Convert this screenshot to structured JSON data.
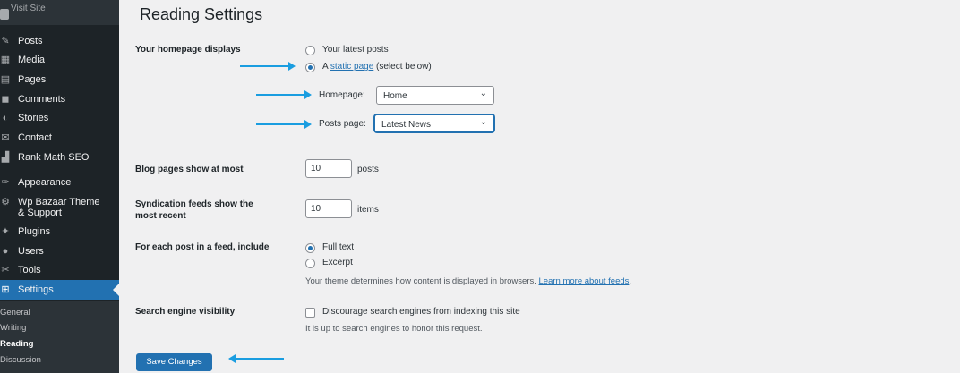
{
  "sidebar": {
    "visit_site": "Visit Site",
    "items": [
      {
        "label": "Posts",
        "icon": "pushpin-icon",
        "glyph": "✎"
      },
      {
        "label": "Media",
        "icon": "media-icon",
        "glyph": "▦"
      },
      {
        "label": "Pages",
        "icon": "pages-icon",
        "glyph": "▤"
      },
      {
        "label": "Comments",
        "icon": "comments-icon",
        "glyph": "◼"
      },
      {
        "label": "Stories",
        "icon": "stories-icon",
        "glyph": "◐"
      },
      {
        "label": "Contact",
        "icon": "contact-icon",
        "glyph": "✉"
      },
      {
        "label": "Rank Math SEO",
        "icon": "rank-math-icon",
        "glyph": "▟"
      },
      {
        "label": "Appearance",
        "icon": "appearance-icon",
        "glyph": "✑"
      },
      {
        "label": "Wp Bazaar Theme",
        "label2": "& Support",
        "icon": "theme-support-icon",
        "glyph": "⚙"
      },
      {
        "label": "Plugins",
        "icon": "plugins-icon",
        "glyph": "✦"
      },
      {
        "label": "Users",
        "icon": "users-icon",
        "glyph": "●"
      },
      {
        "label": "Tools",
        "icon": "tools-icon",
        "glyph": "✂"
      },
      {
        "label": "Settings",
        "icon": "settings-icon",
        "glyph": "⊞"
      }
    ],
    "submenu": [
      "General",
      "Writing",
      "Reading",
      "Discussion"
    ]
  },
  "page": {
    "title": "Reading Settings"
  },
  "homepage_displays": {
    "label": "Your homepage displays",
    "option_latest": "Your latest posts",
    "option_static_prefix": "A ",
    "option_static_link": "static page",
    "option_static_suffix": " (select below)",
    "homepage_label": "Homepage:",
    "homepage_value": "Home",
    "posts_page_label": "Posts page:",
    "posts_page_value": "Latest News"
  },
  "blog_pages": {
    "label": "Blog pages show at most",
    "value": "10",
    "unit": "posts"
  },
  "syndication": {
    "label_line1": "Syndication feeds show the",
    "label_line2": "most recent",
    "value": "10",
    "unit": "items"
  },
  "feed_include": {
    "label": "For each post in a feed, include",
    "option_full": "Full text",
    "option_excerpt": "Excerpt",
    "desc_prefix": "Your theme determines how content is displayed in browsers. ",
    "desc_link": "Learn more about feeds",
    "desc_suffix": "."
  },
  "search_visibility": {
    "label": "Search engine visibility",
    "checkbox_label": "Discourage search engines from indexing this site",
    "desc": "It is up to search engines to honor this request."
  },
  "save_button": "Save Changes",
  "colors": {
    "accent": "#2271b1",
    "sidebar": "#1d2327",
    "arrow": "#1a9de0"
  }
}
